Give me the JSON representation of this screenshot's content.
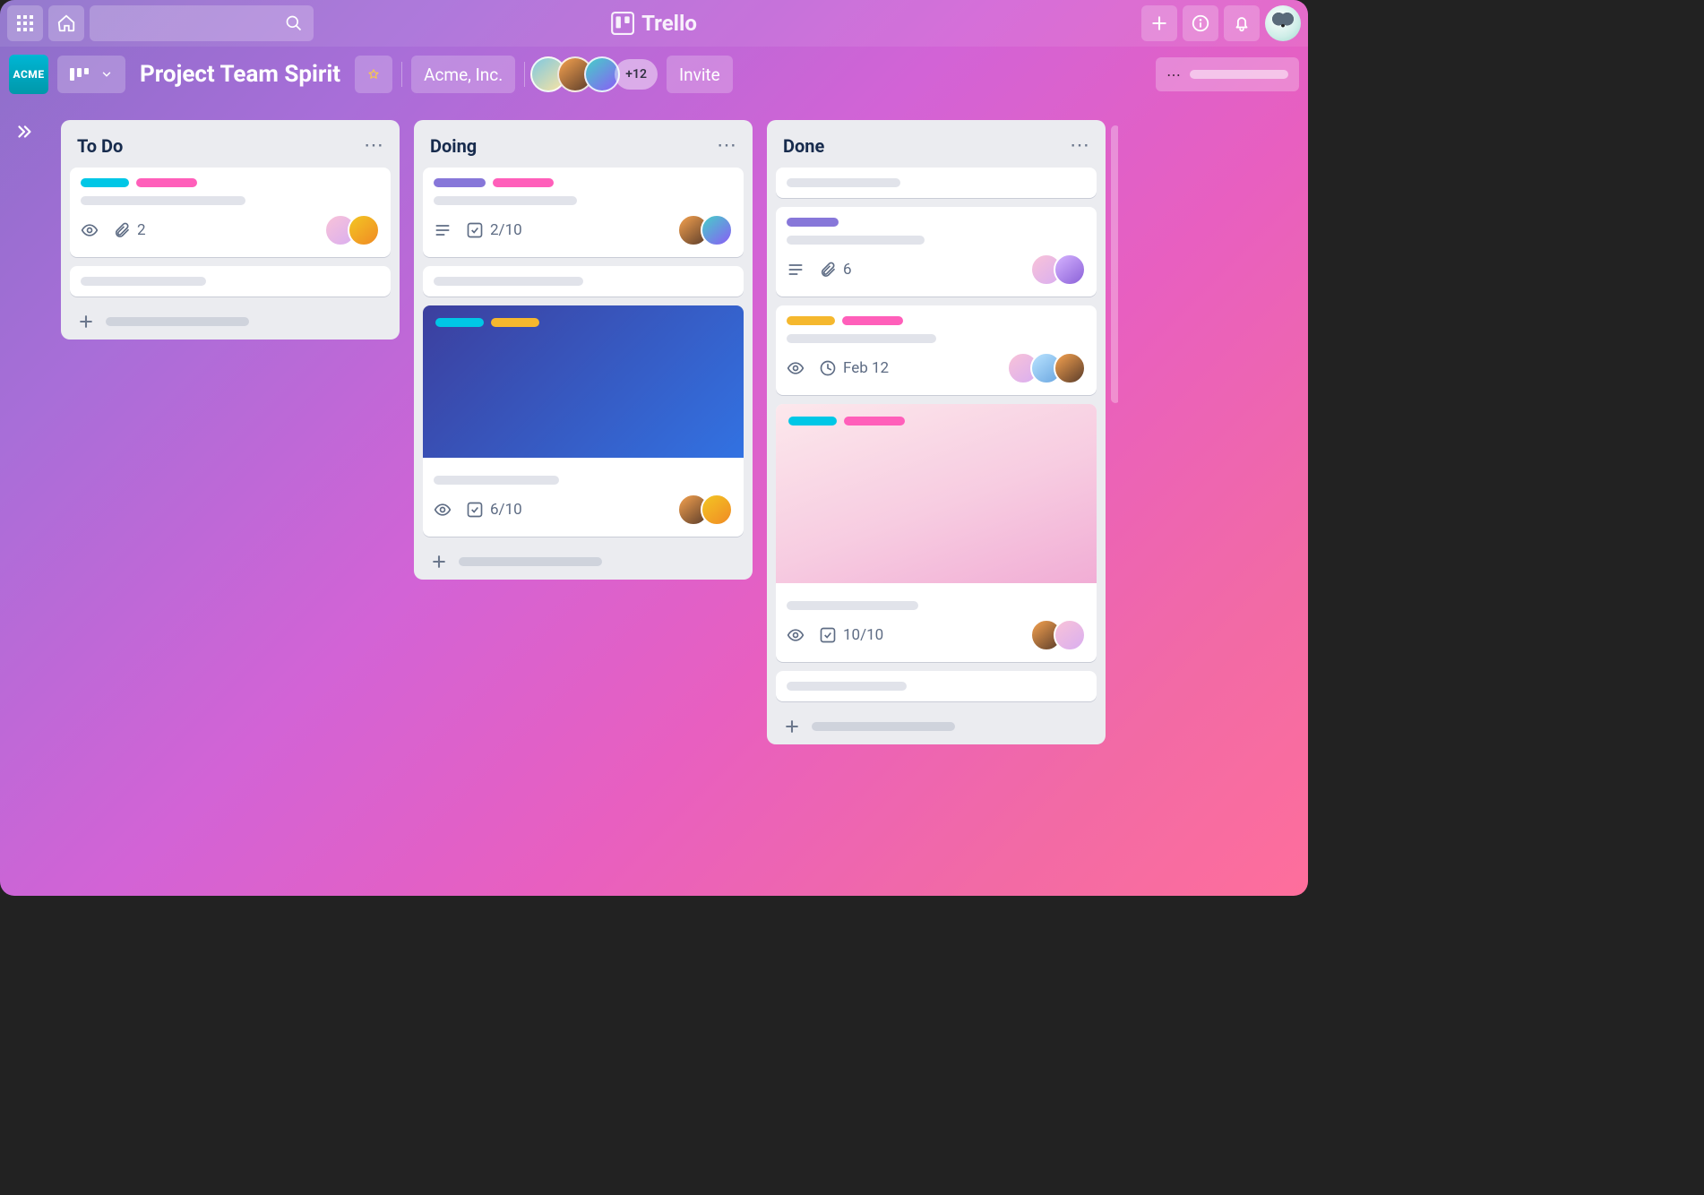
{
  "app": {
    "name": "Trello"
  },
  "board": {
    "team_tile": "ACME",
    "title": "Project Team Spirit",
    "org": "Acme, Inc.",
    "members_overflow": "+12",
    "invite_label": "Invite"
  },
  "lists": [
    {
      "title": "To Do",
      "cards": [
        {
          "labels": [
            "cyan",
            "pink"
          ],
          "watch": true,
          "attachments": "2",
          "members": [
            "av3",
            "av4"
          ]
        },
        {
          "placeholder": true
        }
      ]
    },
    {
      "title": "Doing",
      "cards": [
        {
          "labels": [
            "purple",
            "pink"
          ],
          "description": true,
          "checklist": "2/10",
          "members": [
            "av1",
            "av2"
          ]
        },
        {
          "placeholder": true
        },
        {
          "cover": "blue",
          "cover_labels": [
            "cyan",
            "yellow"
          ],
          "watch": true,
          "checklist": "6/10",
          "members": [
            "av1",
            "av4"
          ]
        }
      ]
    },
    {
      "title": "Done",
      "cards": [
        {
          "placeholder": true
        },
        {
          "labels": [
            "purple"
          ],
          "description": true,
          "attachments": "6",
          "members": [
            "av3",
            "av6"
          ]
        },
        {
          "labels": [
            "yellow",
            "pink"
          ],
          "watch": true,
          "due": "Feb 12",
          "members": [
            "av3",
            "av5",
            "av1"
          ]
        },
        {
          "cover": "pink",
          "cover_labels": [
            "cyan",
            "pink"
          ],
          "watch": true,
          "checklist": "10/10",
          "members": [
            "av1",
            "av3"
          ]
        },
        {
          "placeholder": true
        }
      ]
    }
  ]
}
